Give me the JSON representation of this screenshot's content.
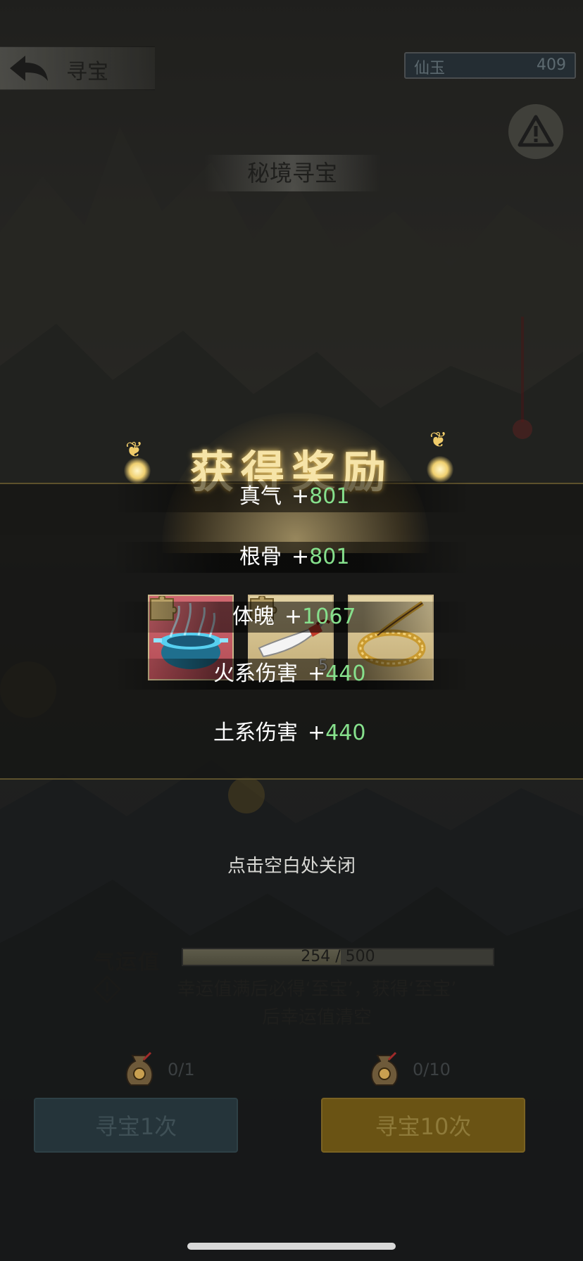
{
  "header": {
    "title": "寻宝",
    "currency_label": "仙玉",
    "currency_value": "409"
  },
  "section_title": "秘境寻宝",
  "reward": {
    "title": "获得奖励",
    "items": [
      {
        "name": "blue-cauldron",
        "frame": "red",
        "puzzle": true
      },
      {
        "name": "sword",
        "frame": "gold",
        "puzzle": true,
        "count": "5"
      },
      {
        "name": "golden-whip",
        "frame": "gold",
        "puzzle": false
      }
    ],
    "stats": [
      {
        "label": "真气",
        "plus": "+",
        "value": "801"
      },
      {
        "label": "根骨",
        "plus": "+",
        "value": "801"
      },
      {
        "label": "体魄",
        "plus": "+",
        "value": "1067"
      },
      {
        "label": "火系伤害",
        "plus": "+",
        "value": "440"
      },
      {
        "label": "土系伤害",
        "plus": "+",
        "value": "440"
      }
    ],
    "close_hint": "点击空白处关闭"
  },
  "luck": {
    "label": "气运值",
    "current": 254,
    "max": 500,
    "text": "254 / 500",
    "note_line1": "幸运值满后必得‘至宝’，获得‘至宝’",
    "note_line2": "后幸运值清空"
  },
  "draws": {
    "single_quota": "0/1",
    "ten_quota": "0/10",
    "single_label": "寻宝1次",
    "ten_label": "寻宝10次"
  },
  "colors": {
    "stat_value": "#86e08c",
    "title_gold": "#f6e4a8",
    "single_button": "#25343a",
    "ten_button": "#6a5314"
  }
}
